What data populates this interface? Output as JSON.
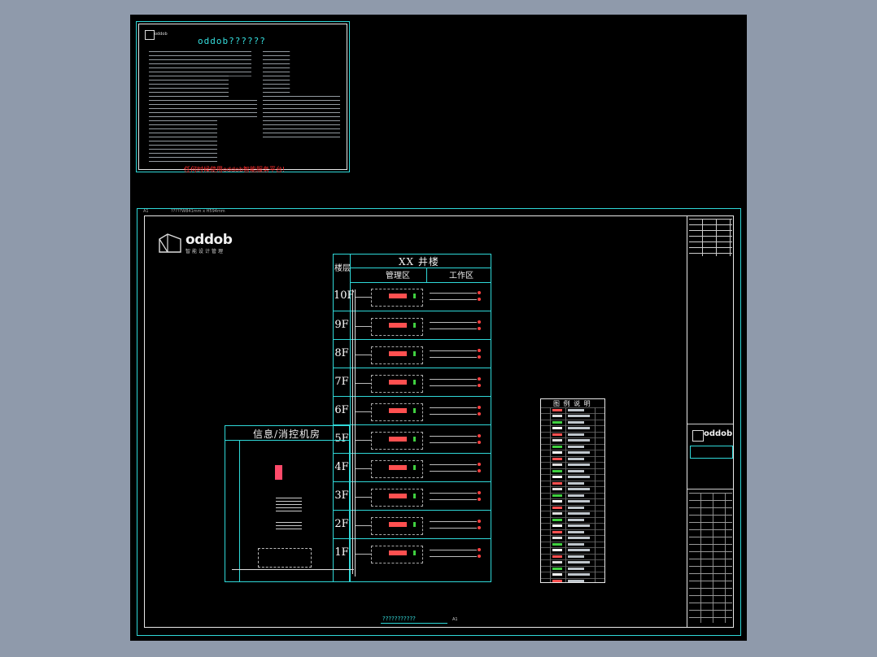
{
  "top_panel": {
    "title": "oddob??????",
    "footer_note": "任何时候使用oddob智能服务平台!"
  },
  "sheet": {
    "size_label": "A1",
    "size_text": "?????W841mm x H594mm",
    "bottom_caption": "???????????",
    "bottom_caption_suffix": "A1"
  },
  "logo": {
    "brand": "oddob",
    "subtitle": "智能设计管理"
  },
  "riser": {
    "building_title": "XX 井楼",
    "floor_col_header": "楼层",
    "zone_header_a": "管理区",
    "zone_header_b": "工作区",
    "floors": [
      "10F",
      "9F",
      "8F",
      "7F",
      "6F",
      "5F",
      "4F",
      "3F",
      "2F",
      "1F"
    ]
  },
  "machine_room": {
    "title": "信息/消控机房"
  },
  "legend": {
    "title": "图 例 说 明"
  },
  "title_block": {
    "brand": "oddob"
  },
  "colors": {
    "frame": "#2fd8d8",
    "accent_red": "#ff2a2a",
    "canvas": "#000000",
    "backdrop": "#8f9aab"
  }
}
